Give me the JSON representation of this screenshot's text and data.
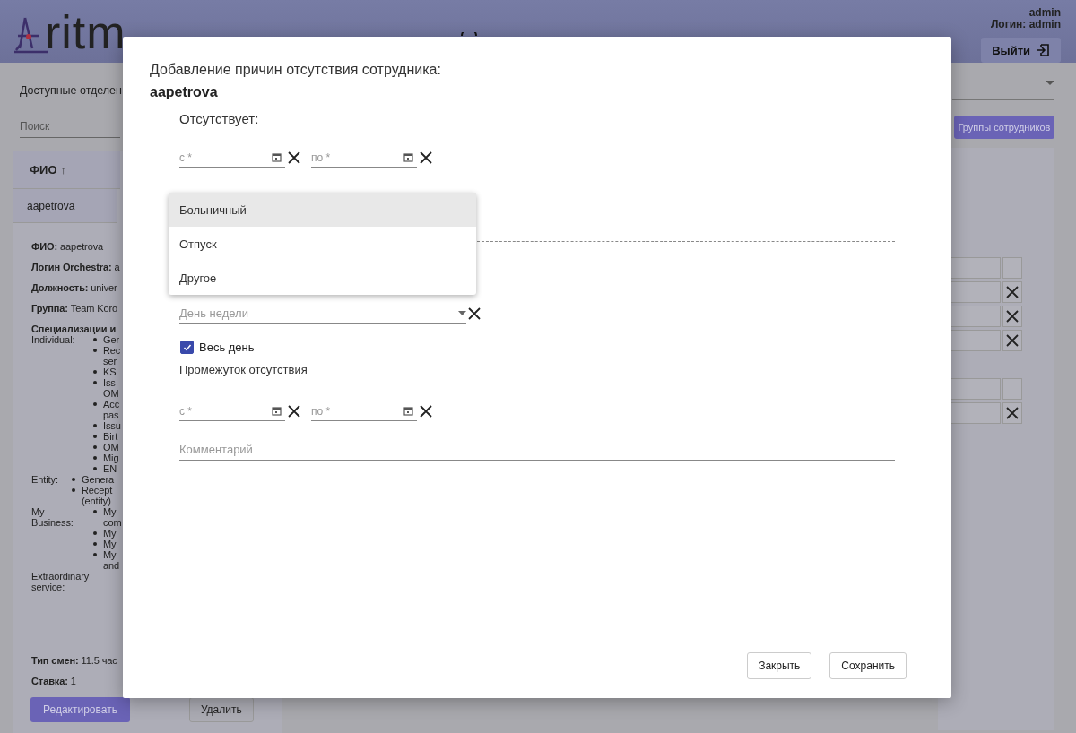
{
  "header": {
    "logo_text": "ritm",
    "user": "admin",
    "login": "Логин: admin",
    "logout": "Выйти"
  },
  "toolbar": {
    "departments_label": "Доступные отделен",
    "search_placeholder": "Поиск",
    "groups_button": "Группы сотрудников"
  },
  "table": {
    "column": "ФИО",
    "sort": "↑",
    "row": "aapetrova"
  },
  "details": [
    {
      "label": "ФИО:",
      "value": "aapetrova"
    },
    {
      "label": "Логин Orchestra:",
      "value": "a"
    },
    {
      "label": "Должность:",
      "value": "univer"
    },
    {
      "label": "Группа:",
      "value": "Team Koro"
    }
  ],
  "specializations_title": "Специализации и",
  "specializations": [
    {
      "group": "Individual:",
      "items": [
        "Ger",
        "Rec ser",
        "KS",
        "Iss OM",
        "Acc pas",
        "Issu",
        "Birt",
        "OM",
        "Mig",
        "EN"
      ]
    },
    {
      "group": "Entity:",
      "items": [
        "Genera",
        "Recept (entity)"
      ]
    },
    {
      "group": "My Business:",
      "items": [
        "My com",
        "My",
        "My",
        "My and"
      ]
    },
    {
      "group": "Extraordinary service:"
    }
  ],
  "shift": {
    "label": "Тип смен:",
    "value": "11.5 час"
  },
  "rate": {
    "label": "Ставка:",
    "value": "1"
  },
  "actions": [
    "Редактировать",
    "Удалить"
  ],
  "right_groups": [
    [
      {
        "removable": false
      },
      {
        "removable": true
      },
      {
        "removable": true
      },
      {
        "removable": true
      }
    ],
    [
      {
        "removable": false
      },
      {
        "removable": true
      }
    ]
  ],
  "dialog": {
    "title": "Добавление причин отсутствия сотрудника:",
    "employee": "aapetrova",
    "absent_label": "Отсутствует:",
    "date_range": [
      {
        "placeholder": "с *"
      },
      {
        "placeholder": "по *"
      }
    ],
    "reason_options": [
      {
        "label": "Больничный",
        "selected": true
      },
      {
        "label": "Отпуск",
        "selected": false
      },
      {
        "label": "Другое",
        "selected": false
      }
    ],
    "weekday": {
      "placeholder": "День недели"
    },
    "all_day": {
      "label": "Весь день",
      "checked": true
    },
    "interval_label": "Промежуток отсутствия",
    "time_range": [
      {
        "placeholder": "с *"
      },
      {
        "placeholder": "по *"
      }
    ],
    "comment": {
      "placeholder": "Комментарий"
    },
    "buttons": [
      "Закрыть",
      "Сохранить"
    ]
  }
}
